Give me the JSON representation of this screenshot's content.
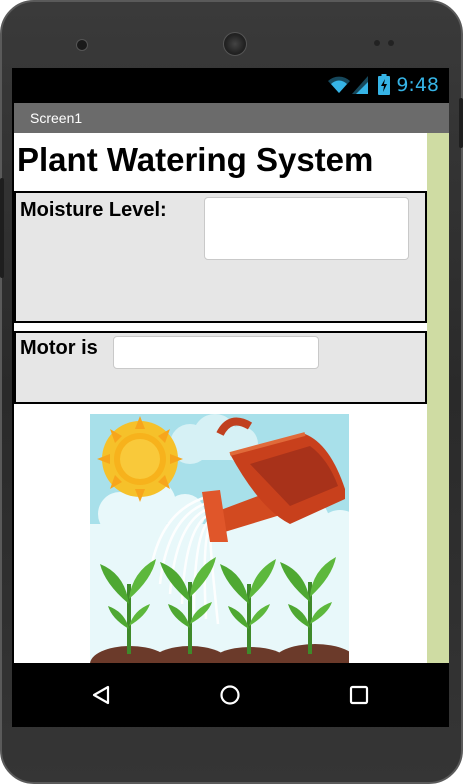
{
  "status_bar": {
    "time": "9:48",
    "icons": [
      "wifi-icon",
      "signal-icon",
      "battery-icon"
    ],
    "accent_color": "#36b4e6"
  },
  "app": {
    "screen_title": "Screen1",
    "heading": "Plant Watering System",
    "moisture": {
      "label": "Moisture Level:",
      "value": ""
    },
    "motor": {
      "label": "Motor is",
      "value": ""
    },
    "illustration": "plant-watering-image"
  },
  "nav_bar": {
    "buttons": [
      "back-icon",
      "home-icon",
      "recents-icon"
    ]
  },
  "colors": {
    "title_bar": "#6b6b6b",
    "panel_bg": "#e6e6e6",
    "side_strip": "#cfdca3"
  }
}
